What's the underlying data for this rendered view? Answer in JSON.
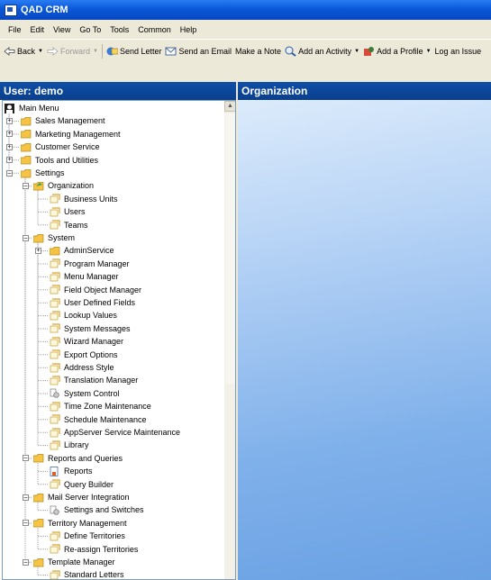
{
  "window": {
    "title": "QAD CRM"
  },
  "menu": [
    "File",
    "Edit",
    "View",
    "Go To",
    "Tools",
    "Common",
    "Help"
  ],
  "toolbar": {
    "back": "Back",
    "forward": "Forward",
    "send_letter": "Send Letter",
    "send_email": "Send an Email",
    "make_note": "Make a Note",
    "add_activity": "Add an Activity",
    "add_profile": "Add a Profile",
    "log_issue": "Log an Issue"
  },
  "left_panel": {
    "title": "User: demo"
  },
  "right_panel": {
    "title": "Organization"
  },
  "tree": [
    {
      "label": "Main Menu",
      "level": 0,
      "icon": "user-icon",
      "expander": ""
    },
    {
      "label": "Sales Management",
      "level": 1,
      "icon": "folder-icon",
      "expander": "+"
    },
    {
      "label": "Marketing Management",
      "level": 1,
      "icon": "folder-icon",
      "expander": "+"
    },
    {
      "label": "Customer Service",
      "level": 1,
      "icon": "folder-icon",
      "expander": "+"
    },
    {
      "label": "Tools and Utilities",
      "level": 1,
      "icon": "folder-icon",
      "expander": "+"
    },
    {
      "label": "Settings",
      "level": 1,
      "icon": "folder-icon",
      "expander": "-"
    },
    {
      "label": "Organization",
      "level": 2,
      "icon": "folder-open-icon",
      "expander": "-",
      "selected": true
    },
    {
      "label": "Business Units",
      "level": 3,
      "icon": "form-icon",
      "expander": ""
    },
    {
      "label": "Users",
      "level": 3,
      "icon": "form-icon",
      "expander": ""
    },
    {
      "label": "Teams",
      "level": 3,
      "icon": "form-icon",
      "expander": ""
    },
    {
      "label": "System",
      "level": 2,
      "icon": "folder-icon",
      "expander": "-"
    },
    {
      "label": "AdminService",
      "level": 3,
      "icon": "folder-icon",
      "expander": "+"
    },
    {
      "label": "Program Manager",
      "level": 3,
      "icon": "form-icon",
      "expander": ""
    },
    {
      "label": "Menu Manager",
      "level": 3,
      "icon": "form-icon",
      "expander": ""
    },
    {
      "label": "Field Object Manager",
      "level": 3,
      "icon": "form-icon",
      "expander": ""
    },
    {
      "label": "User Defined Fields",
      "level": 3,
      "icon": "form-icon",
      "expander": ""
    },
    {
      "label": "Lookup Values",
      "level": 3,
      "icon": "form-icon",
      "expander": ""
    },
    {
      "label": "System Messages",
      "level": 3,
      "icon": "form-icon",
      "expander": ""
    },
    {
      "label": "Wizard Manager",
      "level": 3,
      "icon": "form-icon",
      "expander": ""
    },
    {
      "label": "Export Options",
      "level": 3,
      "icon": "form-icon",
      "expander": ""
    },
    {
      "label": "Address Style",
      "level": 3,
      "icon": "form-icon",
      "expander": ""
    },
    {
      "label": "Translation Manager",
      "level": 3,
      "icon": "form-icon",
      "expander": ""
    },
    {
      "label": "System Control",
      "level": 3,
      "icon": "gear-doc-icon",
      "expander": ""
    },
    {
      "label": "Time Zone Maintenance",
      "level": 3,
      "icon": "form-icon",
      "expander": ""
    },
    {
      "label": "Schedule Maintenance",
      "level": 3,
      "icon": "form-icon",
      "expander": ""
    },
    {
      "label": "AppServer Service Maintenance",
      "level": 3,
      "icon": "form-icon",
      "expander": ""
    },
    {
      "label": "Library",
      "level": 3,
      "icon": "form-icon",
      "expander": ""
    },
    {
      "label": "Reports and Queries",
      "level": 2,
      "icon": "folder-icon",
      "expander": "-"
    },
    {
      "label": "Reports",
      "level": 3,
      "icon": "report-icon",
      "expander": ""
    },
    {
      "label": "Query Builder",
      "level": 3,
      "icon": "form-icon",
      "expander": ""
    },
    {
      "label": "Mail Server Integration",
      "level": 2,
      "icon": "folder-icon",
      "expander": "-"
    },
    {
      "label": "Settings and Switches",
      "level": 3,
      "icon": "gear-doc-icon",
      "expander": ""
    },
    {
      "label": "Territory Management",
      "level": 2,
      "icon": "folder-icon",
      "expander": "-"
    },
    {
      "label": "Define Territories",
      "level": 3,
      "icon": "form-icon",
      "expander": ""
    },
    {
      "label": "Re-assign Territories",
      "level": 3,
      "icon": "form-icon",
      "expander": ""
    },
    {
      "label": "Template Manager",
      "level": 2,
      "icon": "folder-icon",
      "expander": "-"
    },
    {
      "label": "Standard Letters",
      "level": 3,
      "icon": "form-icon",
      "expander": ""
    }
  ],
  "colors": {
    "header_blue": "#0e4fa8",
    "titlebar_blue": "#0a58d8",
    "chrome": "#ece9d8",
    "folder": "#f6c445"
  }
}
